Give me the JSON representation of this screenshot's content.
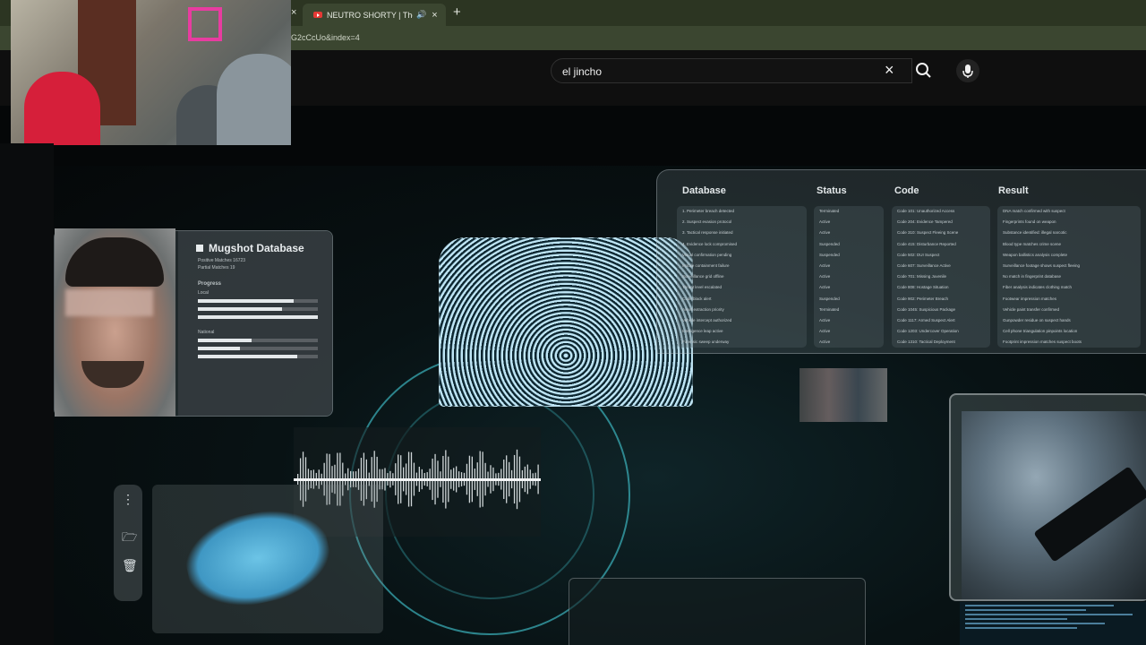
{
  "browser": {
    "active_tab": {
      "title": "NEUTRO SHORTY | The Cy",
      "audio_icon": "🔊",
      "close_icon": "×"
    },
    "prev_tab_close": "×",
    "new_tab": "+",
    "url_fragment": "G2cCcUo&index=4"
  },
  "youtube": {
    "search": {
      "value": "el jincho",
      "clear_icon": "×"
    },
    "search_button_icon": "search-icon",
    "mic_button_icon": "microphone-icon"
  },
  "video": {
    "mugshot": {
      "title": "Mugshot Database",
      "positive_matches": "Positive Matches 16723",
      "partial_matches": "Partial Matches 19",
      "progress_label": "Progress",
      "local_label": "Local",
      "national_label": "National",
      "local_bars": [
        0.8,
        0.7,
        1.0
      ],
      "national_bars": [
        0.45,
        0.35,
        0.83
      ]
    },
    "database": {
      "headers": {
        "database": "Database",
        "status": "Status",
        "code": "Code",
        "result": "Result"
      },
      "rows": [
        {
          "n": "1.",
          "db": "Perimeter breach detected",
          "status": "Terminated",
          "code": "Code 101: Unauthorized Access",
          "result": "DNA match confirmed with suspect"
        },
        {
          "n": "2.",
          "db": "Suspect evasion protocol",
          "status": "Active",
          "code": "Code 204: Evidence Tampered",
          "result": "Fingerprints found on weapon"
        },
        {
          "n": "3.",
          "db": "Tactical response initiated",
          "status": "Active",
          "code": "Code 310: Suspect Fleeing Scene",
          "result": "Substance identified: illegal narcotic"
        },
        {
          "n": "4.",
          "db": "Evidence lock compromised",
          "status": "Suspended",
          "code": "Code 415: Disturbance Reported",
          "result": "Blood type matches crime scene"
        },
        {
          "n": "",
          "db": "Visual confirmation pending",
          "status": "Suspended",
          "code": "Code 502: DUI Suspect",
          "result": "Weapon ballistics analysis complete"
        },
        {
          "n": "",
          "db": "Mobile containment failure",
          "status": "Active",
          "code": "Code 607: Surveillance Active",
          "result": "Surveillance footage shows suspect fleeing"
        },
        {
          "n": "",
          "db": "Surveillance grid offline",
          "status": "Active",
          "code": "Code 701: Missing Juvenile",
          "result": "No match in fingerprint database"
        },
        {
          "n": "",
          "db": "Threat level escalated",
          "status": "Active",
          "code": "Code 808: Hostage Situation",
          "result": "Fiber analysis indicates clothing match"
        },
        {
          "n": "",
          "db": "Code black alert",
          "status": "Suspended",
          "code": "Code 902: Perimeter Breach",
          "result": "Footwear impression matches"
        },
        {
          "n": "",
          "db": "Asset extraction priority",
          "status": "Terminated",
          "code": "Code 1045: Suspicious Package",
          "result": "Vehicle paint transfer confirmed"
        },
        {
          "n": "",
          "db": "Vehicle intercept authorized",
          "status": "Active",
          "code": "Code 1117: Armed Suspect Alert",
          "result": "Gunpowder residue on suspect hands"
        },
        {
          "n": "",
          "db": "Intelligence leap active",
          "status": "Active",
          "code": "Code 1203: Undercover Operation",
          "result": "Cell phone triangulation pinpoints location"
        },
        {
          "n": "",
          "db": "Forensic sweep underway",
          "status": "Active",
          "code": "Code 1310: Tactical Deployment",
          "result": "Footprint impression matches suspect boots"
        }
      ]
    },
    "tools": {
      "menu_icon": "⋮",
      "folder_icon": "🗁",
      "trash_icon": "🗑"
    }
  }
}
